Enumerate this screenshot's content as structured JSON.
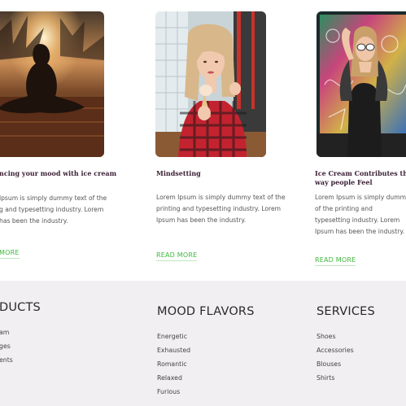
{
  "blog": {
    "cards": [
      {
        "title": "ncing your mood with ice cream",
        "text": "lpsum is simply dummy text of the\ng and typesetting industry. Lorem\nhas been the industry.",
        "read_more": "MORE",
        "image": "meditation-sunset-photo"
      },
      {
        "title": "Mindsetting",
        "text": "Lorem Ipsum is simply dummy text of the\nprinting and typesetting industry. Lorem\nIpsum has been the industry.",
        "read_more": "READ MORE",
        "image": "woman-with-ice-cream-photo"
      },
      {
        "title_lines": [
          "Ice Cream Contributes  the",
          "way people Feel"
        ],
        "text": "Lorem Ipsum is simply dummy text\nof the printing and\ntypesetting industry. Lorem\nIpsum has been the industry.",
        "read_more": "READ MORE",
        "image": "woman-neon-lights-photo"
      }
    ]
  },
  "footer": {
    "columns": [
      {
        "heading": "DUCTS",
        "items": [
          "am",
          "ges",
          "ents"
        ]
      },
      {
        "heading": "MOOD FLAVORS",
        "items": [
          "Energetic",
          "Exhausted",
          "Romantic",
          "Relaxed",
          "Furious"
        ]
      },
      {
        "heading": "SERVICES",
        "items": [
          "Shoes",
          "Accessories",
          "Blouses",
          "Shirts"
        ]
      }
    ]
  },
  "colors": {
    "accent_green": "#3db83a",
    "title_color": "#3b2036",
    "footer_bg": "#f1eff1"
  }
}
